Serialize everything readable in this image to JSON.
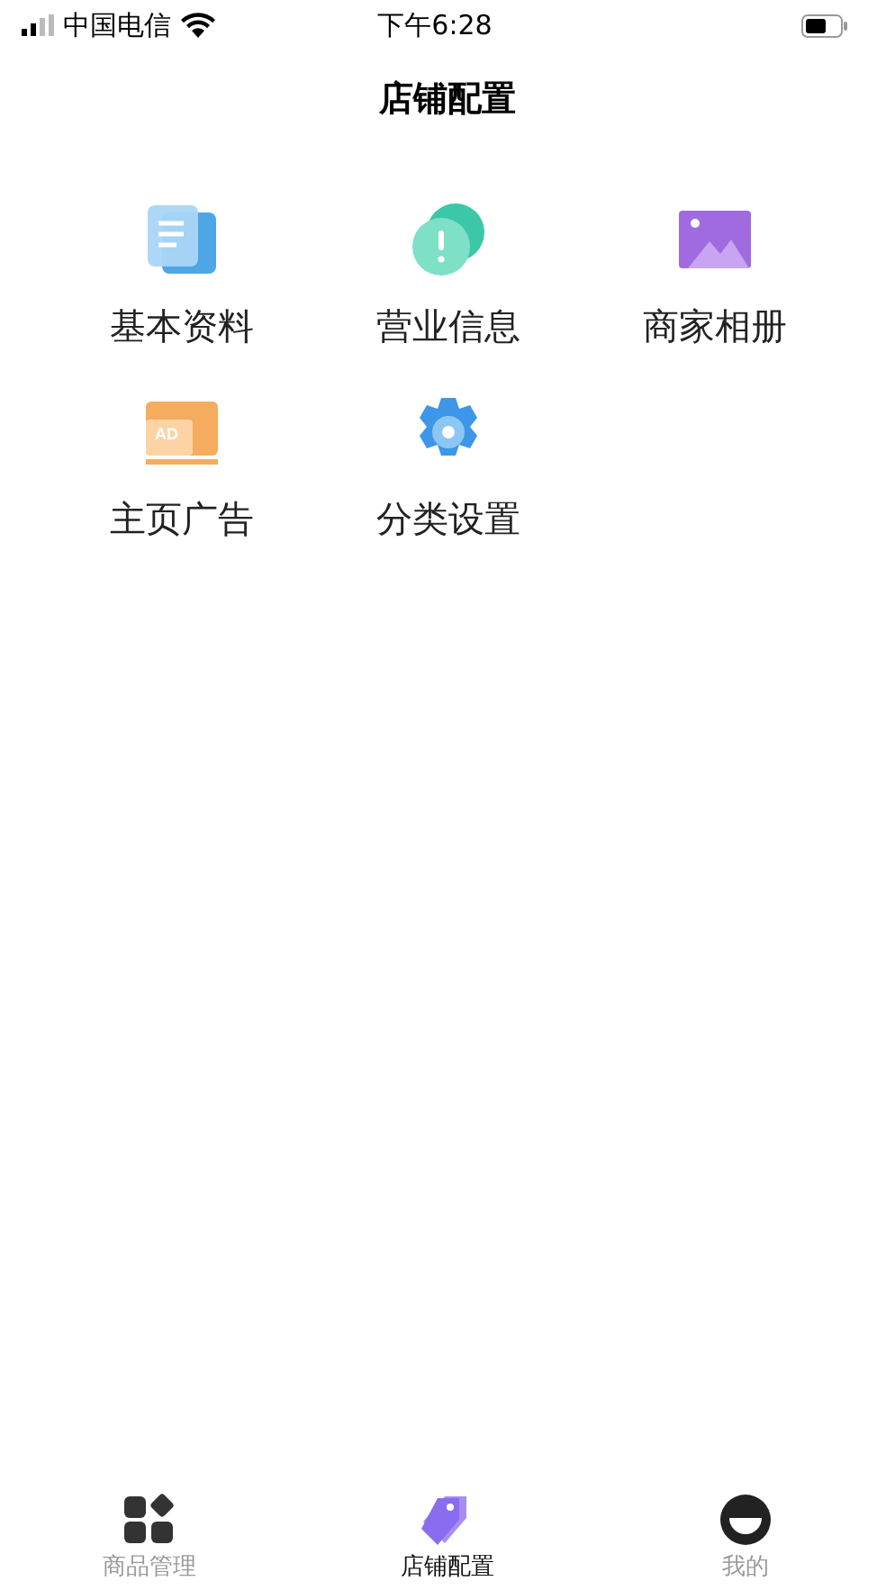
{
  "status_bar": {
    "carrier": "中国电信",
    "time": "下午6:28"
  },
  "title": "店铺配置",
  "items": [
    {
      "label": "基本资料",
      "kind": "document"
    },
    {
      "label": "营业信息",
      "kind": "notice"
    },
    {
      "label": "商家相册",
      "kind": "photo"
    },
    {
      "label": "主页广告",
      "kind": "ad",
      "badge": "AD"
    },
    {
      "label": "分类设置",
      "kind": "gear"
    }
  ],
  "tabs": [
    {
      "label": "商品管理",
      "kind": "grid",
      "selected": false
    },
    {
      "label": "店铺配置",
      "kind": "tag",
      "selected": true
    },
    {
      "label": "我的",
      "kind": "face",
      "selected": false
    }
  ]
}
